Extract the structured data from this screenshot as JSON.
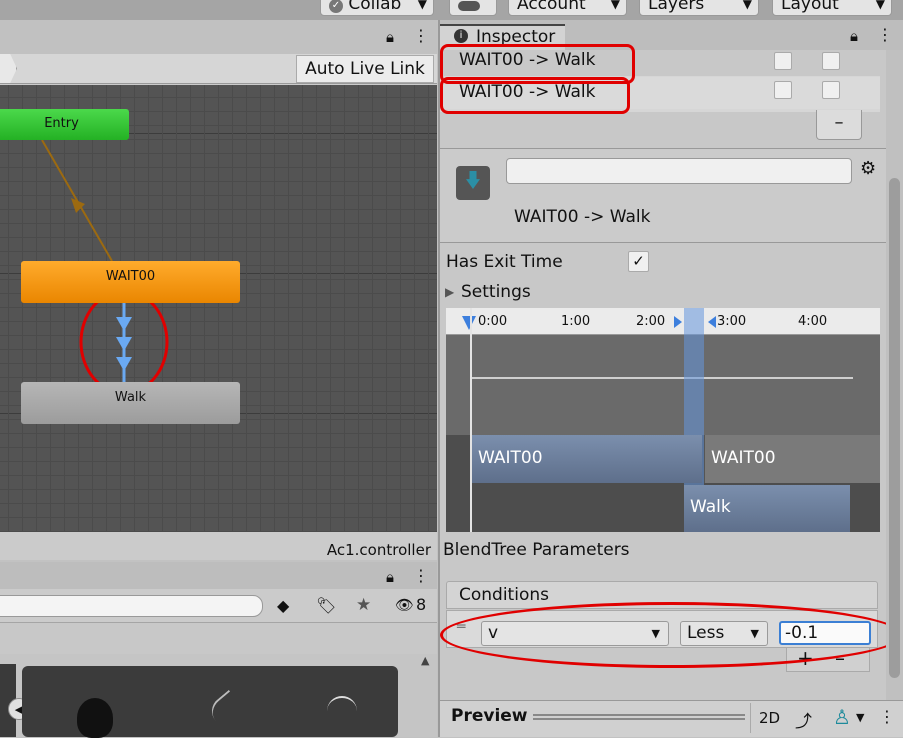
{
  "toolbar": {
    "collab_label": "Collab",
    "account_label": "Account",
    "layers_label": "Layers",
    "layout_label": "Layout"
  },
  "animator": {
    "auto_live_link_label": "Auto Live Link",
    "states": {
      "entry": "Entry",
      "wait": "WAIT00",
      "walk": "Walk"
    },
    "footer_file": "Ac1.controller",
    "entry_color": "#35c435",
    "wait_color": "#f2930f",
    "walk_color": "#a9a9a9",
    "transition_color": "#6aa9f2"
  },
  "project": {
    "hidden_count": "8"
  },
  "inspector": {
    "tab_title": "Inspector",
    "transitions_list": [
      "WAIT00 -> Walk",
      "WAIT00 -> Walk"
    ],
    "remove_label": "–",
    "name_field_value": "",
    "transition_title": "WAIT00 -> Walk",
    "has_exit_time_label": "Has Exit Time",
    "has_exit_time_checked": "✓",
    "settings_label": "Settings",
    "timeline": {
      "ticks": [
        "0:00",
        "1:00",
        "2:00",
        "3:00",
        "4:00"
      ],
      "source_state": "WAIT00",
      "source_state_repeat": "WAIT00",
      "dest_state": "Walk"
    },
    "blendtree_label": "BlendTree Parameters",
    "conditions_header": "Conditions",
    "condition": {
      "parameter": "v",
      "operator": "Less",
      "value": "-0.1"
    },
    "add_label": "+",
    "minus_label": "–",
    "preview_label": "Preview",
    "preview_2d_label": "2D",
    "highlight_color": "#e00000"
  }
}
